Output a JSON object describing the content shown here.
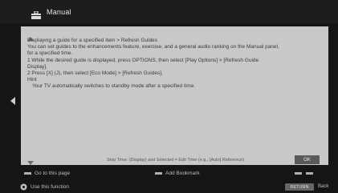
{
  "header": {
    "title": "Manual",
    "icon": "toolbox-icon"
  },
  "panel": {
    "lines": [
      "Displaying a guide for a specified item > Refresh Guides",
      "You can set guides to the enhancements feature, exercise, and a general audio ranking on the Manual panel,",
      "for a specified time.",
      "1  While the desired guide is displayed, press OPTIONS, then select [Play Options] > [Refresh Guide",
      "   Display].",
      "2  Press [X] (J), then select [Eco Mode] > [Refresh Guides].",
      "Hint",
      "    Your TV automatically switches to standby mode after a specified time."
    ],
    "hint_text": "Stop Time: (Display) and Selected = Edit Time (e.g., [Auto] Reference)",
    "ok_label": "OK"
  },
  "footer": {
    "row1": {
      "left_label": "Go to this page",
      "center_label": "Add Bookmark"
    },
    "row2": {
      "left_label": "Use this function",
      "pill_label": "RETURN",
      "back_label": "Back"
    }
  },
  "colors": {
    "panel_bg": "#c8c8c8",
    "screen_bg": "#151515",
    "header_bg": "#1d1d1d"
  }
}
